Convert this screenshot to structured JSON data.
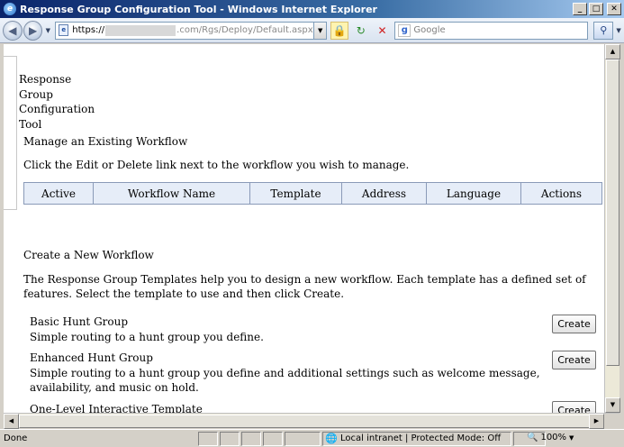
{
  "window": {
    "title": "Response Group Configuration Tool - Windows Internet Explorer",
    "min": "_",
    "max": "□",
    "close": "✕"
  },
  "address": {
    "url_prefix": "https://",
    "url_host": ".com",
    "url_path": "/Rgs/Deploy/Default.aspx",
    "search_placeholder": "Google"
  },
  "page": {
    "app_title": [
      "Response",
      "Group",
      "Configuration",
      "Tool"
    ],
    "manage_heading": "Manage an Existing Workflow",
    "manage_instructions": "Click the Edit or Delete link next to the workflow you wish to manage.",
    "columns": [
      "Active",
      "Workflow Name",
      "Template",
      "Address",
      "Language",
      "Actions"
    ],
    "create_heading": "Create a New Workflow",
    "create_description": "The Response Group Templates help you to design a new workflow. Each template has a defined set of features. Select the template to use and then click Create.",
    "templates": [
      {
        "name": "Basic Hunt Group",
        "description": "Simple routing to a hunt group you define.",
        "button": "Create"
      },
      {
        "name": "Enhanced Hunt Group",
        "description": "Simple routing to a hunt group you define and additional settings such as welcome message, availability, and music on hold.",
        "button": "Create"
      },
      {
        "name": "One-Level Interactive Template",
        "description": "",
        "button": "Create"
      }
    ]
  },
  "status": {
    "left": "Done",
    "zone": "Local intranet | Protected Mode: Off",
    "zoom": "100%"
  },
  "icons": {
    "back": "back-arrow-icon",
    "forward": "forward-arrow-icon",
    "lock": "lock-icon",
    "refresh": "refresh-icon",
    "stop": "stop-icon",
    "search": "magnifier-icon",
    "zone": "intranet-globe-icon"
  },
  "colors": {
    "title_gradient_start": "#0a246a",
    "grid_header_bg": "#e6edf8",
    "grid_border": "#8a9ab8"
  }
}
